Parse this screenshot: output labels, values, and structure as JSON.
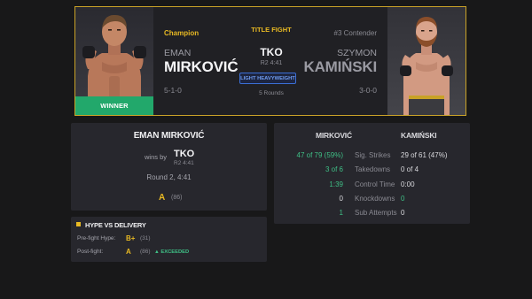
{
  "colors": {
    "accent_gold": "#e8b923",
    "win_green": "#22a86b",
    "stat_green": "#3fbf86",
    "weight_blue": "#3b6fd6",
    "card_border": "#c9a227"
  },
  "fight_card": {
    "winner_label": "WINNER",
    "title_label": "TITLE FIGHT",
    "method": "TKO",
    "time": "R2 4:41",
    "weight_class": "LIGHT HEAVYWEIGHT",
    "rounds": "5 Rounds",
    "left": {
      "role": "Champion",
      "first_name": "EMAN",
      "last_name": "MIRKOVIĆ",
      "record": "5-1-0",
      "portrait": "fighter-portrait-icon"
    },
    "right": {
      "role": "#3 Contender",
      "first_name": "SZYMON",
      "last_name": "KAMIŃSKI",
      "record": "3-0-0",
      "portrait": "fighter-portrait-icon"
    }
  },
  "result": {
    "winner_name": "EMAN MIRKOVIĆ",
    "wins_by": "wins by",
    "method": "TKO",
    "time": "R2 4:41",
    "round_text": "Round 2, 4:41",
    "grade": "A",
    "score": "(86)"
  },
  "stats": {
    "left_header": "MIRKOVIĆ",
    "right_header": "KAMIŃSKI",
    "rows": [
      {
        "label": "Sig. Strikes",
        "left": "47 of 79 (59%)",
        "right": "29 of 61 (47%)"
      },
      {
        "label": "Takedowns",
        "left": "3 of 6",
        "right": "0 of 4"
      },
      {
        "label": "Control Time",
        "left": "1:39",
        "right": "0:00"
      },
      {
        "label": "Knockdowns",
        "left": "0",
        "right": "0"
      },
      {
        "label": "Sub Attempts",
        "left": "1",
        "right": "0"
      }
    ]
  },
  "hype": {
    "title": "HYPE VS DELIVERY",
    "prefight_label": "Pre-fight Hype:",
    "prefight_grade": "B+",
    "prefight_score": "(31)",
    "postfight_label": "Post-fight:",
    "postfight_grade": "A",
    "postfight_score": "(86)",
    "delivery_flag": "▲ EXCEEDED"
  }
}
